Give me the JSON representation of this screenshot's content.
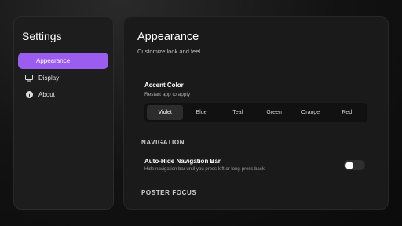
{
  "sidebar": {
    "title": "Settings",
    "items": [
      {
        "label": "Appearance",
        "icon": "palette-icon",
        "active": true
      },
      {
        "label": "Display",
        "icon": "monitor-icon",
        "active": false
      },
      {
        "label": "About",
        "icon": "info-icon",
        "active": false
      }
    ]
  },
  "main": {
    "title": "Appearance",
    "subtitle": "Customize look and feel",
    "accent": {
      "title": "Accent Color",
      "subtitle": "Restart app to apply",
      "options": [
        "Violet",
        "Blue",
        "Teal",
        "Green",
        "Orange",
        "Red"
      ],
      "selected": "Violet"
    },
    "navigation": {
      "heading": "NAVIGATION",
      "auto_hide_title": "Auto-Hide Navigation Bar",
      "auto_hide_desc": "Hide navigation bar until you press left or long-press back",
      "auto_hide_enabled": false
    },
    "poster_focus": {
      "heading": "POSTER FOCUS"
    }
  },
  "colors": {
    "accent": "#9b5cf0",
    "background": "#0e0e0e",
    "panel": "#1a1a1a"
  }
}
